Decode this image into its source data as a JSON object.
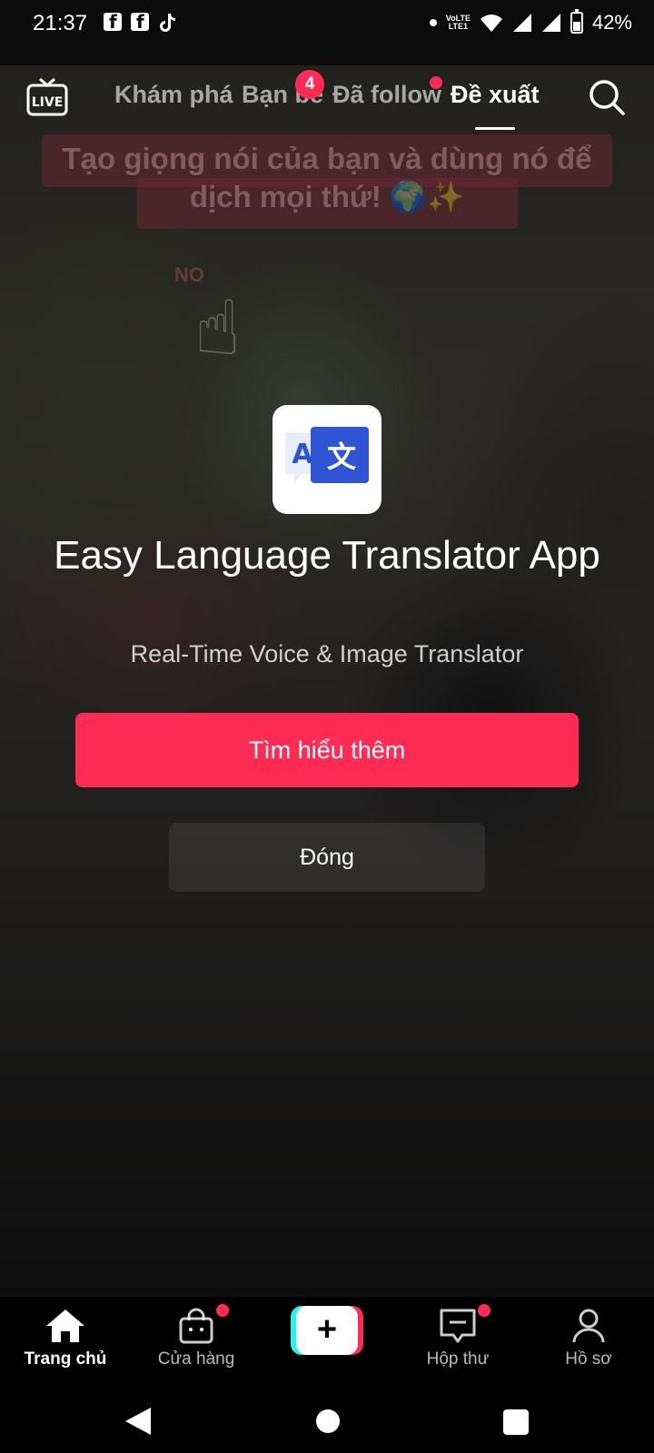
{
  "status_bar": {
    "time": "21:37",
    "network_label": "Vo)\nLTE1",
    "battery": "42%"
  },
  "video": {
    "caption": "Tạo giọng nói của bạn và dùng nó để dịch mọi thứ! 🌍✨",
    "sticker_text": "NO"
  },
  "top_nav": {
    "tabs": [
      {
        "label": "Khám phá",
        "active": false
      },
      {
        "label": "Bạn bè",
        "active": false,
        "badge": "4"
      },
      {
        "label": "Đã follow",
        "active": false,
        "dot": true
      },
      {
        "label": "Đề xuất",
        "active": true
      }
    ],
    "live_label": "LIVE"
  },
  "ad": {
    "app_name": "Easy Language Translator App",
    "subtitle": "Real-Time Voice & Image Translator",
    "cta_label": "Tìm hiểu thêm",
    "close_label": "Đóng",
    "icon_letters": [
      "A",
      "文"
    ]
  },
  "bottom_nav": {
    "items": [
      {
        "label": "Trang chủ",
        "icon": "home-icon",
        "active": true
      },
      {
        "label": "Cửa hàng",
        "icon": "shop-bag-icon",
        "dot": true
      },
      {
        "label": "",
        "icon": "create-plus-icon"
      },
      {
        "label": "Hộp thư",
        "icon": "inbox-icon",
        "dot": true
      },
      {
        "label": "Hồ sơ",
        "icon": "profile-icon"
      }
    ]
  },
  "colors": {
    "accent": "#fe2c55",
    "accent_cyan": "#25f4ee",
    "translator_blue": "#2f55d4"
  }
}
